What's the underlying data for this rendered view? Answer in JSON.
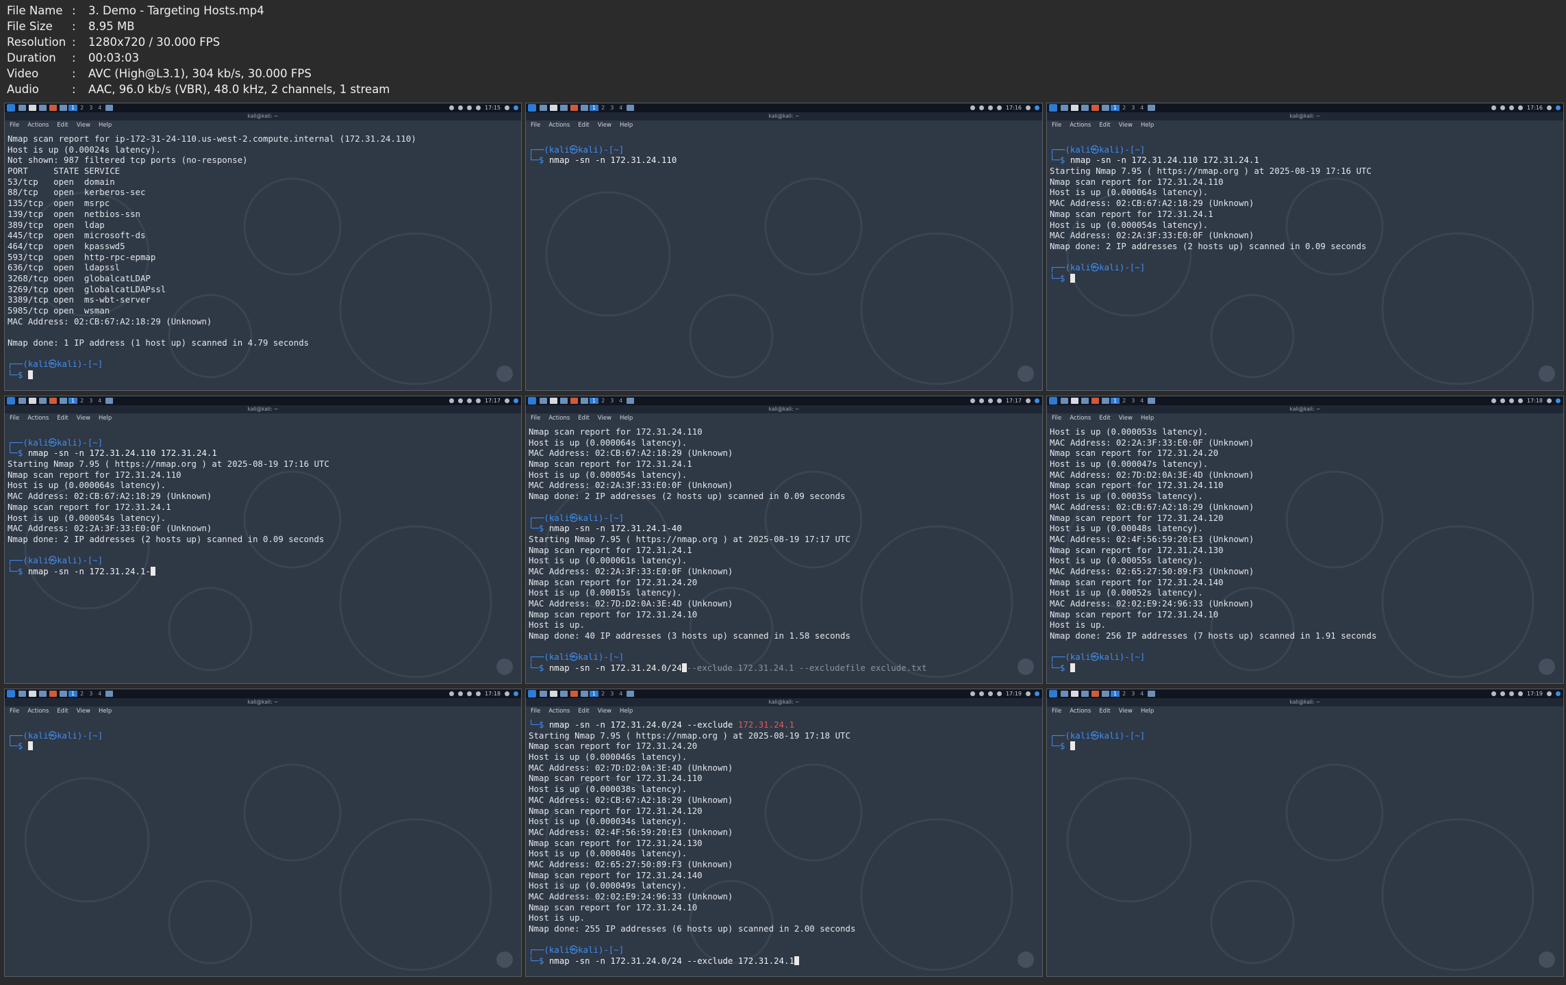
{
  "file_info": [
    {
      "label": "File Name",
      "value": "3. Demo - Targeting Hosts.mp4"
    },
    {
      "label": "File Size",
      "value": "8.95 MB"
    },
    {
      "label": "Resolution",
      "value": "1280x720 / 30.000 FPS"
    },
    {
      "label": "Duration",
      "value": "00:03:03"
    },
    {
      "label": "Video",
      "value": "AVC (High@L3.1), 304 kb/s, 30.000 FPS"
    },
    {
      "label": "Audio",
      "value": "AAC, 96.0 kb/s (VBR), 48.0 kHz, 2 channels, 1 stream"
    }
  ],
  "window_title": "kali@kali: ~",
  "menu": [
    "File",
    "Actions",
    "Edit",
    "View",
    "Help"
  ],
  "workspaces": [
    "1",
    "2",
    "3",
    "4"
  ],
  "frames": [
    {
      "clock": "17:15",
      "lines": [
        {
          "t": "Nmap scan report for ip-172-31-24-110.us-west-2.compute.internal (172.31.24.110)"
        },
        {
          "t": "Host is up (0.00024s latency)."
        },
        {
          "t": "Not shown: 987 filtered tcp ports (no-response)"
        },
        {
          "t": "PORT     STATE SERVICE"
        },
        {
          "t": "53/tcp   open  domain"
        },
        {
          "t": "88/tcp   open  kerberos-sec"
        },
        {
          "t": "135/tcp  open  msrpc"
        },
        {
          "t": "139/tcp  open  netbios-ssn"
        },
        {
          "t": "389/tcp  open  ldap"
        },
        {
          "t": "445/tcp  open  microsoft-ds"
        },
        {
          "t": "464/tcp  open  kpasswd5"
        },
        {
          "t": "593/tcp  open  http-rpc-epmap"
        },
        {
          "t": "636/tcp  open  ldapssl"
        },
        {
          "t": "3268/tcp open  globalcatLDAP"
        },
        {
          "t": "3269/tcp open  globalcatLDAPssl"
        },
        {
          "t": "3389/tcp open  ms-wbt-server"
        },
        {
          "t": "5985/tcp open  wsman"
        },
        {
          "t": "MAC Address: 02:CB:67:A2:18:29 (Unknown)"
        },
        {
          "t": ""
        },
        {
          "t": "Nmap done: 1 IP address (1 host up) scanned in 4.79 seconds"
        },
        {
          "t": ""
        },
        {
          "p": "┌──(kali㉿kali)-[~]"
        },
        {
          "c": "",
          "cursor": true
        }
      ]
    },
    {
      "clock": "17:16",
      "lines": [
        {
          "t": ""
        },
        {
          "p": "┌──(kali㉿kali)-[~]"
        },
        {
          "c": "nmap -sn -n 172.31.24.110"
        }
      ]
    },
    {
      "clock": "17:16",
      "lines": [
        {
          "t": ""
        },
        {
          "p": "┌──(kali㉿kali)-[~]"
        },
        {
          "c": "nmap -sn -n 172.31.24.110 172.31.24.1"
        },
        {
          "t": "Starting Nmap 7.95 ( https://nmap.org ) at 2025-08-19 17:16 UTC"
        },
        {
          "t": "Nmap scan report for 172.31.24.110"
        },
        {
          "t": "Host is up (0.000064s latency)."
        },
        {
          "t": "MAC Address: 02:CB:67:A2:18:29 (Unknown)"
        },
        {
          "t": "Nmap scan report for 172.31.24.1"
        },
        {
          "t": "Host is up (0.000054s latency)."
        },
        {
          "t": "MAC Address: 02:2A:3F:33:E0:0F (Unknown)"
        },
        {
          "t": "Nmap done: 2 IP addresses (2 hosts up) scanned in 0.09 seconds"
        },
        {
          "t": ""
        },
        {
          "p": "┌──(kali㉿kali)-[~]"
        },
        {
          "c": "",
          "cursor": true
        }
      ]
    },
    {
      "clock": "17:17",
      "lines": [
        {
          "t": ""
        },
        {
          "p": "┌──(kali㉿kali)-[~]"
        },
        {
          "c": "nmap -sn -n 172.31.24.110 172.31.24.1"
        },
        {
          "t": "Starting Nmap 7.95 ( https://nmap.org ) at 2025-08-19 17:16 UTC"
        },
        {
          "t": "Nmap scan report for 172.31.24.110"
        },
        {
          "t": "Host is up (0.000064s latency)."
        },
        {
          "t": "MAC Address: 02:CB:67:A2:18:29 (Unknown)"
        },
        {
          "t": "Nmap scan report for 172.31.24.1"
        },
        {
          "t": "Host is up (0.000054s latency)."
        },
        {
          "t": "MAC Address: 02:2A:3F:33:E0:0F (Unknown)"
        },
        {
          "t": "Nmap done: 2 IP addresses (2 hosts up) scanned in 0.09 seconds"
        },
        {
          "t": ""
        },
        {
          "p": "┌──(kali㉿kali)-[~]"
        },
        {
          "c": "nmap -sn -n 172.31.24.1-",
          "cursor": true
        }
      ]
    },
    {
      "clock": "17:17",
      "lines": [
        {
          "t": "Nmap scan report for 172.31.24.110"
        },
        {
          "t": "Host is up (0.000064s latency)."
        },
        {
          "t": "MAC Address: 02:CB:67:A2:18:29 (Unknown)"
        },
        {
          "t": "Nmap scan report for 172.31.24.1"
        },
        {
          "t": "Host is up (0.000054s latency)."
        },
        {
          "t": "MAC Address: 02:2A:3F:33:E0:0F (Unknown)"
        },
        {
          "t": "Nmap done: 2 IP addresses (2 hosts up) scanned in 0.09 seconds"
        },
        {
          "t": ""
        },
        {
          "p": "┌──(kali㉿kali)-[~]"
        },
        {
          "c": "nmap -sn -n 172.31.24.1-40"
        },
        {
          "t": "Starting Nmap 7.95 ( https://nmap.org ) at 2025-08-19 17:17 UTC"
        },
        {
          "t": "Nmap scan report for 172.31.24.1"
        },
        {
          "t": "Host is up (0.000061s latency)."
        },
        {
          "t": "MAC Address: 02:2A:3F:33:E0:0F (Unknown)"
        },
        {
          "t": "Nmap scan report for 172.31.24.20"
        },
        {
          "t": "Host is up (0.00015s latency)."
        },
        {
          "t": "MAC Address: 02:7D:D2:0A:3E:4D (Unknown)"
        },
        {
          "t": "Nmap scan report for 172.31.24.10"
        },
        {
          "t": "Host is up."
        },
        {
          "t": "Nmap done: 40 IP addresses (3 hosts up) scanned in 1.58 seconds"
        },
        {
          "t": ""
        },
        {
          "p": "┌──(kali㉿kali)-[~]"
        },
        {
          "c": "nmap -sn -n 172.31.24.0/24",
          "cursor": true,
          "suggest": "--exclude 172.31.24.1 --excludefile exclude.txt"
        }
      ]
    },
    {
      "clock": "17:18",
      "lines": [
        {
          "t": "Host is up (0.000053s latency)."
        },
        {
          "t": "MAC Address: 02:2A:3F:33:E0:0F (Unknown)"
        },
        {
          "t": "Nmap scan report for 172.31.24.20"
        },
        {
          "t": "Host is up (0.000047s latency)."
        },
        {
          "t": "MAC Address: 02:7D:D2:0A:3E:4D (Unknown)"
        },
        {
          "t": "Nmap scan report for 172.31.24.110"
        },
        {
          "t": "Host is up (0.00035s latency)."
        },
        {
          "t": "MAC Address: 02:CB:67:A2:18:29 (Unknown)"
        },
        {
          "t": "Nmap scan report for 172.31.24.120"
        },
        {
          "t": "Host is up (0.00048s latency)."
        },
        {
          "t": "MAC Address: 02:4F:56:59:20:E3 (Unknown)"
        },
        {
          "t": "Nmap scan report for 172.31.24.130"
        },
        {
          "t": "Host is up (0.00055s latency)."
        },
        {
          "t": "MAC Address: 02:65:27:50:89:F3 (Unknown)"
        },
        {
          "t": "Nmap scan report for 172.31.24.140"
        },
        {
          "t": "Host is up (0.00052s latency)."
        },
        {
          "t": "MAC Address: 02:02:E9:24:96:33 (Unknown)"
        },
        {
          "t": "Nmap scan report for 172.31.24.10"
        },
        {
          "t": "Host is up."
        },
        {
          "t": "Nmap done: 256 IP addresses (7 hosts up) scanned in 1.91 seconds"
        },
        {
          "t": ""
        },
        {
          "p": "┌──(kali㉿kali)-[~]"
        },
        {
          "c": "",
          "cursor": true
        }
      ]
    },
    {
      "clock": "17:18",
      "lines": [
        {
          "t": ""
        },
        {
          "p": "┌──(kali㉿kali)-[~]"
        },
        {
          "c": "",
          "cursor": true
        }
      ]
    },
    {
      "clock": "17:19",
      "lines": [
        {
          "c": "nmap -sn -n 172.31.24.0/24 --exclude 172.31.24.1",
          "excl": true
        },
        {
          "t": "Starting Nmap 7.95 ( https://nmap.org ) at 2025-08-19 17:18 UTC"
        },
        {
          "t": "Nmap scan report for 172.31.24.20"
        },
        {
          "t": "Host is up (0.000046s latency)."
        },
        {
          "t": "MAC Address: 02:7D:D2:0A:3E:4D (Unknown)"
        },
        {
          "t": "Nmap scan report for 172.31.24.110"
        },
        {
          "t": "Host is up (0.000038s latency)."
        },
        {
          "t": "MAC Address: 02:CB:67:A2:18:29 (Unknown)"
        },
        {
          "t": "Nmap scan report for 172.31.24.120"
        },
        {
          "t": "Host is up (0.000034s latency)."
        },
        {
          "t": "MAC Address: 02:4F:56:59:20:E3 (Unknown)"
        },
        {
          "t": "Nmap scan report for 172.31.24.130"
        },
        {
          "t": "Host is up (0.000040s latency)."
        },
        {
          "t": "MAC Address: 02:65:27:50:89:F3 (Unknown)"
        },
        {
          "t": "Nmap scan report for 172.31.24.140"
        },
        {
          "t": "Host is up (0.000049s latency)."
        },
        {
          "t": "MAC Address: 02:02:E9:24:96:33 (Unknown)"
        },
        {
          "t": "Nmap scan report for 172.31.24.10"
        },
        {
          "t": "Host is up."
        },
        {
          "t": "Nmap done: 255 IP addresses (6 hosts up) scanned in 2.00 seconds"
        },
        {
          "t": ""
        },
        {
          "p": "┌──(kali㉿kali)-[~]"
        },
        {
          "c": "nmap -sn -n 172.31.24.0/24 --exclude 172.31.24.1",
          "cursor": true
        }
      ]
    },
    {
      "clock": "17:19",
      "lines": [
        {
          "t": ""
        },
        {
          "p": "┌──(kali㉿kali)-[~]"
        },
        {
          "c": "",
          "cursor": true
        }
      ]
    }
  ]
}
